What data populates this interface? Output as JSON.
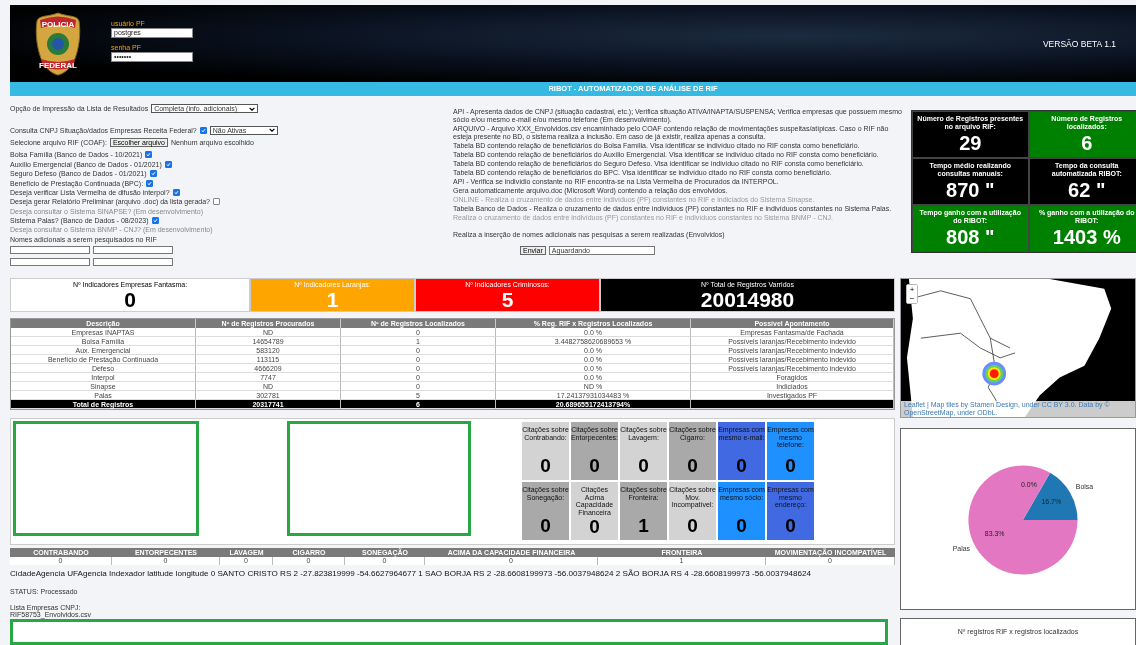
{
  "header": {
    "logo_top": "POLICIA",
    "logo_bottom": "FEDERAL",
    "user_label": "usuário PF",
    "user_value": "postgres",
    "password_label": "senha PF",
    "password_value": "•••••••",
    "version": "VERSÃO BETA 1.1"
  },
  "title_bar": "RIBOT - AUTOMATIZADOR DE ANÁLISE DE RIF",
  "form": {
    "print_option": {
      "label": "Opção de Impressão da Lista de Resultados",
      "value": "Completa (info. adicionais)"
    },
    "cnpj": {
      "label": "Consulta CNPJ Situação/dados Empresas Receita Federal?",
      "checked": true,
      "value": "Não Ativas"
    },
    "file": {
      "label": "Selecione arquivo RIF (COAF):",
      "button": "Escolher arquivo",
      "status": "Nenhum arquivo escolhido"
    },
    "options": [
      {
        "kind": "checkbox",
        "label": "Bolsa Família (Banco de Dados - 10/2021)",
        "checked": true
      },
      {
        "kind": "checkbox",
        "label": "Auxílio Emergencial (Banco de Dados - 01/2021)",
        "checked": true
      },
      {
        "kind": "checkbox",
        "label": "Seguro Defeso (Banco de Dados - 01/2021)",
        "checked": true
      },
      {
        "kind": "checkbox",
        "label": "Benefício de Prestação Continuada (BPC):",
        "checked": true
      },
      {
        "kind": "checkbox",
        "label": "Deseja verificar Lista Vermelha de difusão interpol?",
        "checked": true
      },
      {
        "kind": "checkbox",
        "label": "Deseja gerar Relatório Preliminar (arquivo .doc) da lista gerada?",
        "checked": false
      },
      {
        "kind": "note",
        "label": "Deseja consultar o Sistema SINAPSE? (Em desenvolvimento)"
      },
      {
        "kind": "checkbox",
        "label": "Sistema Palas? (Banco de Dados - 08/2023)",
        "checked": true
      },
      {
        "kind": "note",
        "label": "Deseja consultar o Sistema BNMP - CNJ? (Em desenvolvimento)"
      }
    ],
    "names_label": "Nomes adicionais a serem pesquisados no RIF"
  },
  "descriptions": [
    {
      "text": "API - Apresenta dados de CNPJ (situação cadastral, etc.); Verifica situação ATIVA/INAPTA/SUSPENSA; Verifica empresas que possuem mesmo sócio e/ou mesmo e-mail e/ou mesmo telefone (Em desenvolvimento).",
      "disabled": false
    },
    {
      "text": "ARQUIVO - Arquivo XXX_Envolvidos.csv encaminhado pelo COAF contendo relação de movimentações suspeitas/atípicas. Caso o RIF não esteja presente no BD, o sistema realiza a inclusão. Em caso de já existir, realiza apenas a consulta.",
      "disabled": false
    },
    {
      "text": "Tabela BD contendo relação de beneficiários do Bolsa Família. Visa identificar se indivíduo citado no RIF consta como beneficiário.",
      "disabled": false
    },
    {
      "text": "Tabela BD contendo relação de beneficiários do Auxílio Emergencial. Visa identificar se indivíduo citado no RIF consta como beneficiário.",
      "disabled": false
    },
    {
      "text": "Tabela BD contendo relação de beneficiários do Seguro Defeso. Visa identificar se indivíduo citado no RIF consta como beneficiário.",
      "disabled": false
    },
    {
      "text": "Tabela BD contendo relação de beneficiários do BPC. Visa identificar se indivíduo citado no RIF consta como beneficiário.",
      "disabled": false
    },
    {
      "text": "API - Verifica se indivídio constante no RIF encontra-se na Lista Vermelha de Procurados da INTERPOL.",
      "disabled": false
    },
    {
      "text": "Gera automaticamente arquivo.doc (Microsoft Word) contendo a relação dos envolvidos.",
      "disabled": false
    },
    {
      "text": "ONLINE - Realiza o cruzamento de dados entre indivíduos (PF) constantes no RIF e indiciados do Sistema Sinapse.",
      "disabled": true
    },
    {
      "text": "Tabela Banco de Dados - Realiza o cruzamento de dados entre indivíduos (PF) constantes no RIF e indivíduos constantes no Sistema Palas.",
      "disabled": false
    },
    {
      "text": "Realiza o cruzamento de dados entre indivíduos (PF) constantes no RIF e indivíduos constantes no Sistema BNMP - CNJ.",
      "disabled": true
    }
  ],
  "extra_description": "Realiza a inserção de nomes adicionais nas pesquisas a serem realizadas (Envolvidos)",
  "submit": {
    "button": "Enviar",
    "status": "Aguardando"
  },
  "stats": [
    {
      "label": "Número de Registros presentes no arquivo RIF:",
      "value": "29",
      "color": "#000000"
    },
    {
      "label": "Número de Registros localizados:",
      "value": "6",
      "color": "#008000"
    },
    {
      "label": "Tempo médio realizando consultas manuais:",
      "value": "870 \"",
      "color": "#000000"
    },
    {
      "label": "Tempo da consulta automatizada RIBOT:",
      "value": "62 \"",
      "color": "#000000"
    },
    {
      "label": "Tempo ganho com a utilização do RIBOT:",
      "value": "808 \"",
      "color": "#008000"
    },
    {
      "label": "% ganho com a utilização do RIBOT:",
      "value": "1403 %",
      "color": "#008000"
    }
  ],
  "indicators": [
    {
      "label": "Nº Indicadores Empresas Fantasma:",
      "value": "0",
      "color": "#ffffff"
    },
    {
      "label": "Nº Indicadores Laranjas:",
      "value": "1",
      "color": "#ffa500"
    },
    {
      "label": "Nº Indicadores Criminosos:",
      "value": "5",
      "color": "#ff0000"
    },
    {
      "label": "Nº Total de Registros Varridos",
      "value": "20014980",
      "color": "#000000"
    }
  ],
  "table": {
    "columns": [
      "Descrição",
      "Nº de Registros Procurados",
      "Nº de Registros Localizados",
      "% Reg. RIF x Registros Localizados",
      "Possível Apontamento"
    ],
    "rows": [
      [
        "Empresas INAPTAS",
        "ND",
        "0",
        "0.0 %",
        "Empresas Fantasma/de Fachada"
      ],
      [
        "Bolsa Família",
        "14654789",
        "1",
        "3.4482758620689653 %",
        "Possíveis laranjas/Recebimento indevido"
      ],
      [
        "Aux. Emergencial",
        "583120",
        "0",
        "0.0 %",
        "Possíveis laranjas/Recebimento indevido"
      ],
      [
        "Benefício de Prestação Continuada",
        "113115",
        "0",
        "0.0 %",
        "Possíveis laranjas/Recebimento indevido"
      ],
      [
        "Defeso",
        "4666209",
        "0",
        "0.0 %",
        "Possíveis laranjas/Recebimento indevido"
      ],
      [
        "Interpol",
        "7747",
        "0",
        "0.0 %",
        "Foragidos"
      ],
      [
        "Sinapse",
        "ND",
        "0",
        "ND %",
        "Indiciados"
      ],
      [
        "Palas",
        "302781",
        "5",
        "17.24137931034483 %",
        "Investigados PF"
      ]
    ],
    "total": [
      "Total de Registros",
      "20317741",
      "6",
      "20.689655172413794%"
    ]
  },
  "citations": [
    {
      "label": "Citações sobre Contrabando:",
      "value": "0",
      "color": "#d3d3d3"
    },
    {
      "label": "Citações sobre Entorpecentes:",
      "value": "0",
      "color": "#a9a9a9"
    },
    {
      "label": "Citações sobre Lavagem:",
      "value": "0",
      "color": "#d3d3d3"
    },
    {
      "label": "Citações sobre Cigarro:",
      "value": "0",
      "color": "#a9a9a9"
    },
    {
      "label": "Empresas com mesmo e-mail:",
      "value": "0",
      "color": "#4169e1"
    },
    {
      "label": "Empresas com mesmo telefone:",
      "value": "0",
      "color": "#1e90ff"
    },
    {
      "label": "Citações sobre Sonegação:",
      "value": "0",
      "color": "#a9a9a9"
    },
    {
      "label": "Citações Acima Capacidade Financeira",
      "value": "0",
      "color": "#d3d3d3"
    },
    {
      "label": "Citações sobre Fronteira:",
      "value": "1",
      "color": "#a9a9a9"
    },
    {
      "label": "Citações sobre Mov. Incompatível:",
      "value": "0",
      "color": "#d3d3d3"
    },
    {
      "label": "Empresas com mesmo sócio:",
      "value": "0",
      "color": "#1e90ff"
    },
    {
      "label": "Empresas com mesmo endereço:",
      "value": "0",
      "color": "#4169e1"
    }
  ],
  "crime_table": {
    "columns": [
      "CONTRABANDO",
      "ENTORPECENTES",
      "LAVAGEM",
      "CIGARRO",
      "SONEGAÇÃO",
      "ACIMA DA CAPACIDADE FINANCEIRA",
      "FRONTEIRA",
      "MOVIMENTAÇÃO INCOMPATÍVEL"
    ],
    "values": [
      "0",
      "0",
      "0",
      "0",
      "0",
      "0",
      "1",
      "0"
    ]
  },
  "locations_text": "CidadeAgencia UFAgencia Indexador latitude longitude 0 SANTO CRISTO RS 2 -27.823819999 -54.6627964677 1 SAO BORJA RS 2 -28.6608199973 -56.0037948624 2 SÃO BORJA RS 4 -28.6608199973 -56.0037948624",
  "status": "STATUS: Processado",
  "company_list_label": "Lista Empresas CNPJ:",
  "file_name": "RIF58753_Envolvidos.csv",
  "map": {
    "zoom_in": "+",
    "zoom_out": "−",
    "attribution": "Leaflet | Map tiles by Stamen Design, under CC BY 3.0. Data by © OpenStreetMap, under ODbL."
  },
  "pie": {
    "chart_data": {
      "type": "pie",
      "categories": [
        "Bolsa",
        "Palas"
      ],
      "values": [
        16.7,
        83.3
      ],
      "colors": [
        "#1f77b4",
        "#e377c2"
      ],
      "value_labels": [
        "16.7%",
        "83.3%"
      ],
      "annotations": [
        "0.0%"
      ]
    }
  },
  "bar_panel_title": "Nº registros RIF x registros localizados"
}
